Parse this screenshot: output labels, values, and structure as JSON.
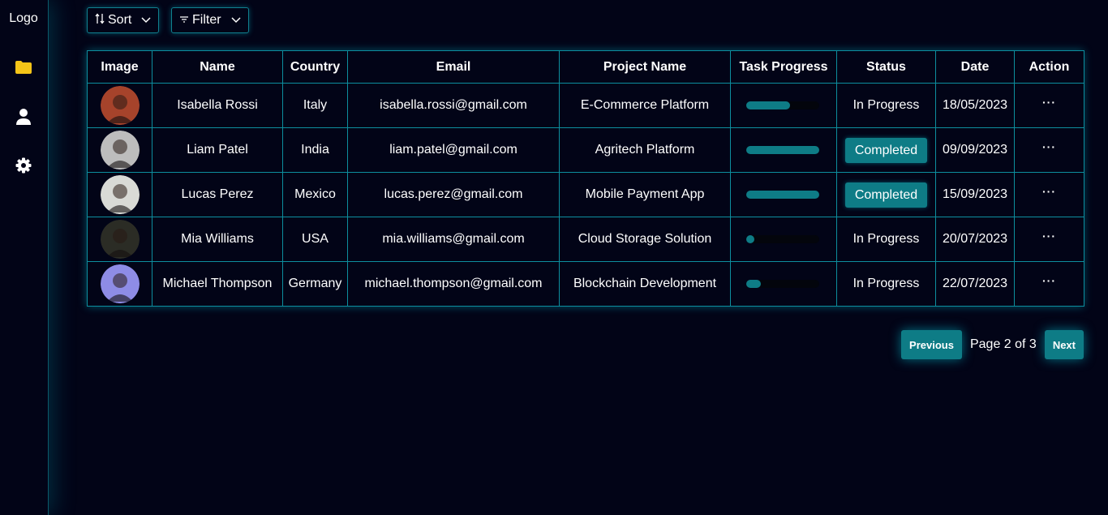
{
  "sidebar": {
    "logo": "Logo",
    "icons": [
      "folder-icon",
      "user-icon",
      "gear-icon"
    ],
    "active_color": "#f5c518"
  },
  "toolbar": {
    "sort_label": "Sort",
    "filter_label": "Filter"
  },
  "table": {
    "headers": [
      "Image",
      "Name",
      "Country",
      "Email",
      "Project Name",
      "Task Progress",
      "Status",
      "Date",
      "Action"
    ],
    "rows": [
      {
        "name": "Isabella Rossi",
        "country": "Italy",
        "email": "isabella.rossi@gmail.com",
        "project": "E-Commerce Platform",
        "progress": 0.6,
        "status": "In Progress",
        "date": "18/05/2023",
        "action": "···",
        "avatar_color": "#a6432b"
      },
      {
        "name": "Liam Patel",
        "country": "India",
        "email": "liam.patel@gmail.com",
        "project": "Agritech Platform",
        "progress": 1.0,
        "status": "Completed",
        "date": "09/09/2023",
        "action": "···",
        "avatar_color": "#bdbdbd"
      },
      {
        "name": "Lucas Perez",
        "country": "Mexico",
        "email": "lucas.perez@gmail.com",
        "project": "Mobile Payment App",
        "progress": 1.0,
        "status": "Completed",
        "date": "15/09/2023",
        "action": "···",
        "avatar_color": "#d9dad6"
      },
      {
        "name": "Mia Williams",
        "country": "USA",
        "email": "mia.williams@gmail.com",
        "project": "Cloud Storage Solution",
        "progress": 0.1,
        "status": "In Progress",
        "date": "20/07/2023",
        "action": "···",
        "avatar_color": "#2b2c25"
      },
      {
        "name": "Michael Thompson",
        "country": "Germany",
        "email": "michael.thompson@gmail.com",
        "project": "Blockchain Development",
        "progress": 0.2,
        "status": "In Progress",
        "date": "22/07/2023",
        "action": "···",
        "avatar_color": "#8e8ce6"
      }
    ]
  },
  "pagination": {
    "previous_label": "Previous",
    "page_text": "Page 2 of 3",
    "next_label": "Next"
  },
  "colors": {
    "background": "#020417",
    "accent": "#0e7c86",
    "border": "#0d8e9e"
  }
}
